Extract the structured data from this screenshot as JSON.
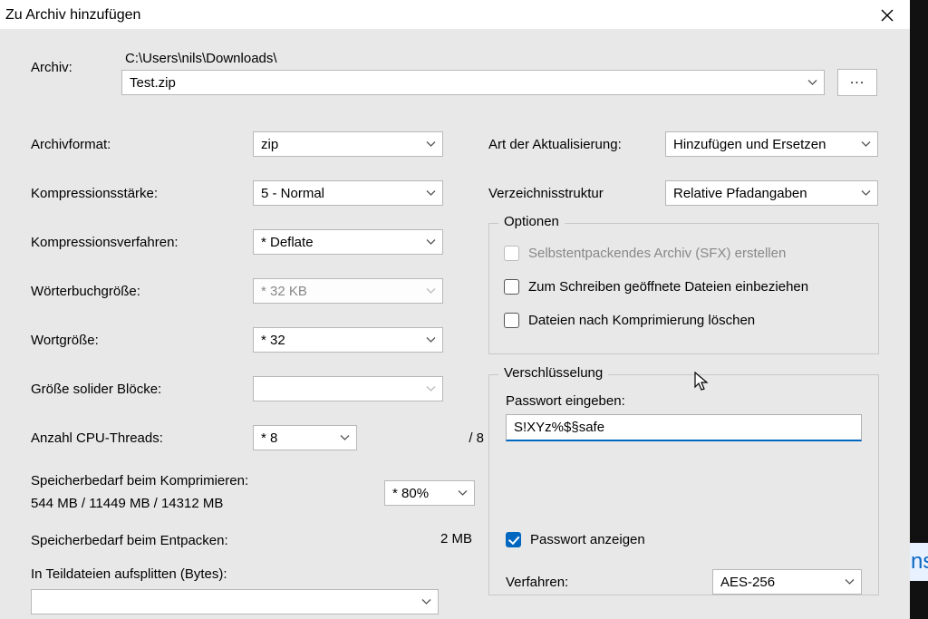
{
  "title": "Zu Archiv hinzufügen",
  "archive": {
    "label": "Archiv:",
    "path": "C:\\Users\\nils\\Downloads\\",
    "filename": "Test.zip",
    "browse": "..."
  },
  "left": {
    "format_label": "Archivformat:",
    "format_value": "zip",
    "level_label": "Kompressionsstärke:",
    "level_value": "5 - Normal",
    "method_label": "Kompressionsverfahren:",
    "method_value": "*  Deflate",
    "dict_label": "Wörterbuchgröße:",
    "dict_value": "*  32 KB",
    "word_label": "Wortgröße:",
    "word_value": "*  32",
    "block_label": "Größe solider Blöcke:",
    "block_value": "",
    "threads_label": "Anzahl CPU-Threads:",
    "threads_value": "*  8",
    "threads_total": "/ 8",
    "mem_compress_label": "Speicherbedarf beim Komprimieren:",
    "mem_compress_detail": "544 MB / 11449 MB / 14312 MB",
    "mem_percent": "* 80%",
    "mem_decompress_label": "Speicherbedarf beim Entpacken:",
    "mem_decompress_value": "2 MB",
    "split_label": "In Teildateien aufsplitten (Bytes):"
  },
  "right": {
    "update_label": "Art der Aktualisierung:",
    "update_value": "Hinzufügen und Ersetzen",
    "paths_label": "Verzeichnisstruktur",
    "paths_value": "Relative Pfadangaben",
    "options_legend": "Optionen",
    "sfx_label": "Selbstentpackendes Archiv (SFX) erstellen",
    "shared_label": "Zum Schreiben geöffnete Dateien einbeziehen",
    "delete_label": "Dateien nach Komprimierung löschen",
    "encrypt_legend": "Verschlüsselung",
    "pwd_label": "Passwort eingeben:",
    "pwd_value": "S!XYz%$§safe",
    "showpwd_label": "Passwort anzeigen",
    "enc_method_label": "Verfahren:",
    "enc_method_value": "AES-256"
  },
  "strip_text": "ns"
}
